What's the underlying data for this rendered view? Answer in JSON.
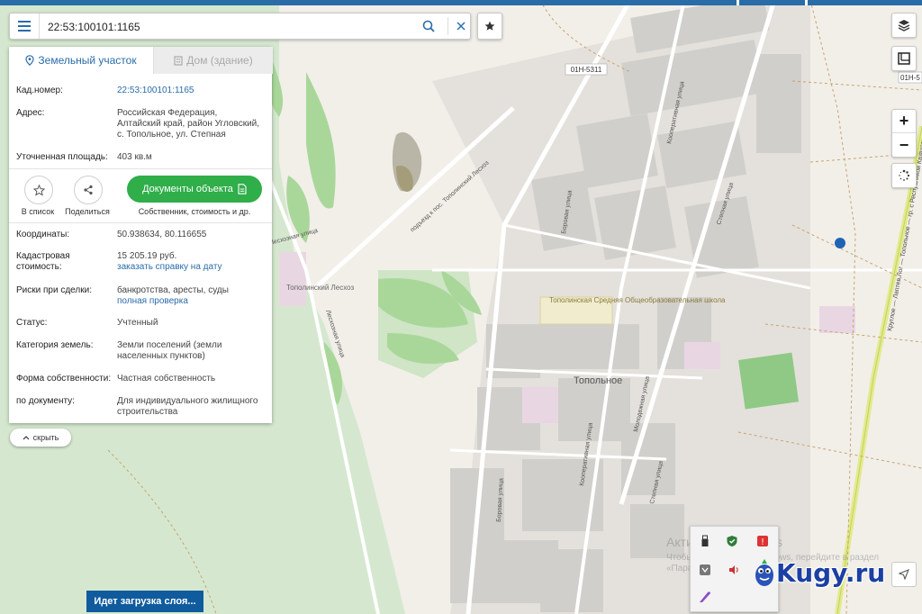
{
  "search": {
    "value": "22:53:100101:1165",
    "placeholder": ""
  },
  "tabs": [
    {
      "label": "Земельный участок"
    },
    {
      "label": "Дом (здание)"
    }
  ],
  "info1": [
    {
      "label": "Кад.номер:",
      "value": "22:53:100101:1165"
    },
    {
      "label": "Адрес:",
      "value": "Российская Федерация, Алтайский край, район Угловский, с. Топольное, ул. Степная"
    },
    {
      "label": "Уточненная площадь:",
      "value": "403 кв.м"
    }
  ],
  "actions": {
    "add_to_list": "В список",
    "share": "Поделиться",
    "documents": "Документы объекта",
    "documents_sub": "Собственник, стоимость и др."
  },
  "info2": {
    "coords": {
      "label": "Координаты:",
      "value": "50.938634, 80.116655"
    },
    "cost": {
      "label": "Кадастровая стоимость:",
      "value": "15 205.19 руб.",
      "link": "заказать справку на дату"
    },
    "risks": {
      "label": "Риски при сделки:",
      "value": "банкротства, аресты, суды",
      "link": "полная проверка"
    },
    "status": {
      "label": "Статус:",
      "value": "Учтенный"
    },
    "category": {
      "label": "Категория земель:",
      "value": "Земли поселений (земли населенных пунктов)"
    },
    "ownership": {
      "label": "Форма собственности:",
      "value": "Частная собственность"
    },
    "by_doc": {
      "label": "по документу:",
      "value": "Для индивидуального жилищного строительства"
    }
  },
  "hide_label": "скрыть",
  "loading": "Идет загрузка слоя...",
  "map_labels": {
    "road1": "01Н-5311",
    "road2": "01Н-5",
    "village": "Топольное",
    "les": "Тополинский Лесхоз",
    "school": "Тополинская Средняя Общеобразовательная школа",
    "road_les": "подъезд к пос. Тополинский Лесхоз",
    "st_boro1": "Боровая улица",
    "st_boro2": "Боровая улица",
    "st_koop1": "Кооперативная улица",
    "st_koop2": "Кооперативная улица",
    "st_step1": "Степная улица",
    "st_step2": "Степная улица",
    "st_mol": "Молодежная улица",
    "st_les": "Лесхозная улица",
    "st_les2": "Лесхозная улица",
    "hwy": "Круглое — Лаптев Лог — Топольное — гр. с Республикой Казахстан"
  },
  "watermark": {
    "line1": "Активация Windows",
    "line2": "Чтобы активировать Windows, перейдите в раздел «Параметры»."
  },
  "brand": "Kugy.ru",
  "colors": {
    "accent": "#2a6ca8",
    "green_button": "#2fae4a",
    "loading_bg": "#0f5b9e",
    "marker": "#1f63b4"
  }
}
